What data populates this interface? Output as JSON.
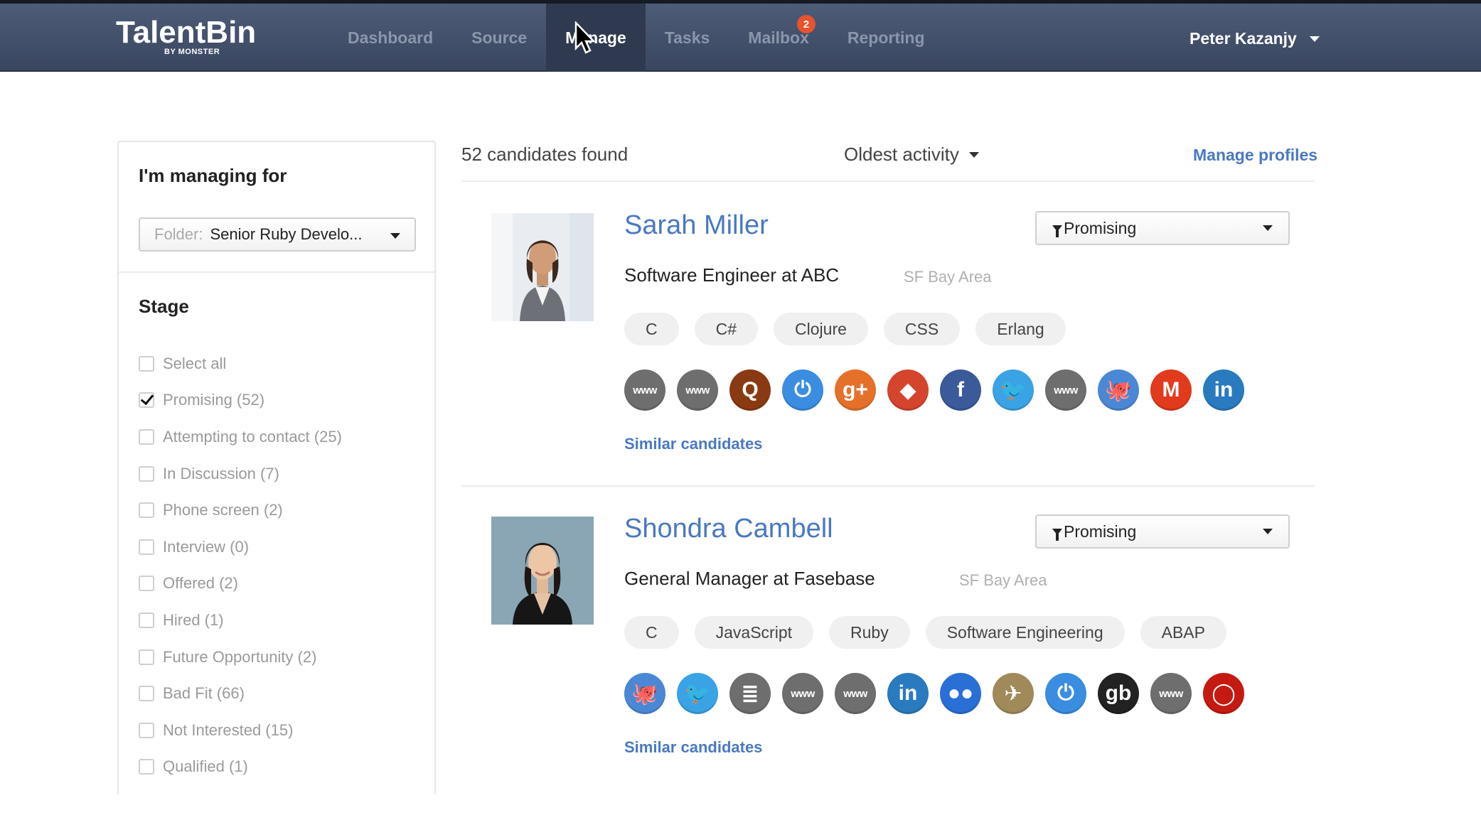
{
  "app": {
    "logo_main": "TalentBin",
    "logo_sub": "BY MONSTER"
  },
  "nav": {
    "items": [
      {
        "label": "Dashboard"
      },
      {
        "label": "Source"
      },
      {
        "label": "Manage"
      },
      {
        "label": "Tasks"
      },
      {
        "label": "Mailbox"
      },
      {
        "label": "Reporting"
      }
    ],
    "mailbox_badge": "2",
    "active": "Manage",
    "user_name": "Peter Kazanjy"
  },
  "sidebar": {
    "managing_title": "I'm managing for",
    "folder_label": "Folder:",
    "folder_value": "Senior Ruby Develo...",
    "stage_title": "Stage",
    "stages": [
      {
        "label": "Select all",
        "checked": false
      },
      {
        "label": "Promising (52)",
        "checked": true
      },
      {
        "label": "Attempting to contact (25)",
        "checked": false
      },
      {
        "label": "In Discussion (7)",
        "checked": false
      },
      {
        "label": "Phone screen (2)",
        "checked": false
      },
      {
        "label": "Interview (0)",
        "checked": false
      },
      {
        "label": "Offered (2)",
        "checked": false
      },
      {
        "label": "Hired (1)",
        "checked": false
      },
      {
        "label": "Future Opportunity (2)",
        "checked": false
      },
      {
        "label": "Bad Fit (66)",
        "checked": false
      },
      {
        "label": "Not Interested (15)",
        "checked": false
      },
      {
        "label": "Qualified (1)",
        "checked": false
      }
    ]
  },
  "results": {
    "count_text": "52 candidates found",
    "sort_label": "Oldest activity",
    "manage_link": "Manage profiles"
  },
  "candidates": [
    {
      "name": "Sarah Miller",
      "title": "Software Engineer at",
      "company": "ABC",
      "location": "SF Bay Area",
      "stage": "Promising",
      "tags": [
        "C",
        "C#",
        "Clojure",
        "CSS",
        "Erlang"
      ],
      "socials": [
        {
          "icon": "www-icon",
          "glyph": "www",
          "color": "#6e6e6e"
        },
        {
          "icon": "www-icon",
          "glyph": "www",
          "color": "#6e6e6e"
        },
        {
          "icon": "quora-icon",
          "glyph": "Q",
          "color": "#8a3a12"
        },
        {
          "icon": "power-icon",
          "glyph": "⏻",
          "color": "#3a8de0"
        },
        {
          "icon": "google-plus-icon",
          "glyph": "g+",
          "color": "#e5702a"
        },
        {
          "icon": "ruby-gem-icon",
          "glyph": "◆",
          "color": "#d5442d"
        },
        {
          "icon": "facebook-icon",
          "glyph": "f",
          "color": "#3b5a9a"
        },
        {
          "icon": "twitter-icon",
          "glyph": "🐦",
          "color": "#3aa3e6"
        },
        {
          "icon": "www-icon",
          "glyph": "www",
          "color": "#6e6e6e"
        },
        {
          "icon": "github-icon",
          "glyph": "🐙",
          "color": "#4a88d6"
        },
        {
          "icon": "meetup-icon",
          "glyph": "M",
          "color": "#e23a1c"
        },
        {
          "icon": "linkedin-icon",
          "glyph": "in",
          "color": "#2a7ac0"
        }
      ],
      "similar_label": "Similar candidates"
    },
    {
      "name": "Shondra Cambell",
      "title": "General Manager at",
      "company": "Fasebase",
      "location": "SF Bay Area",
      "stage": "Promising",
      "tags": [
        "C",
        "JavaScript",
        "Ruby",
        "Software Engineering",
        "ABAP"
      ],
      "socials": [
        {
          "icon": "github-icon",
          "glyph": "🐙",
          "color": "#4a88d6"
        },
        {
          "icon": "twitter-icon",
          "glyph": "🐦",
          "color": "#3aa3e6"
        },
        {
          "icon": "stack-overflow-icon",
          "glyph": "≣",
          "color": "#6e6e6e"
        },
        {
          "icon": "www-icon",
          "glyph": "www",
          "color": "#6e6e6e"
        },
        {
          "icon": "www-icon",
          "glyph": "www",
          "color": "#6e6e6e"
        },
        {
          "icon": "linkedin-icon",
          "glyph": "in",
          "color": "#2a7ac0"
        },
        {
          "icon": "flickr-icon",
          "glyph": "●●",
          "color": "#2a6fd6"
        },
        {
          "icon": "bird-icon",
          "glyph": "✈",
          "color": "#a08a5a"
        },
        {
          "icon": "power-icon",
          "glyph": "⏻",
          "color": "#3a8de0"
        },
        {
          "icon": "goodreads-icon",
          "glyph": "gb",
          "color": "#222222"
        },
        {
          "icon": "www-icon",
          "glyph": "www",
          "color": "#6e6e6e"
        },
        {
          "icon": "lastfm-icon",
          "glyph": "◯",
          "color": "#c41a12"
        }
      ],
      "similar_label": "Similar candidates"
    }
  ]
}
